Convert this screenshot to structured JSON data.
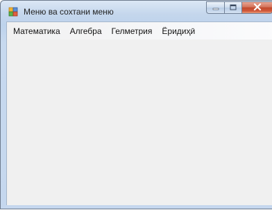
{
  "window": {
    "title": "Меню ва сохтани меню",
    "icon": "form-icon",
    "caption_buttons": {
      "minimize_icon": "minimize-icon",
      "maximize_icon": "maximize-icon",
      "close_icon": "close-icon"
    }
  },
  "menubar": {
    "items": [
      {
        "label": "Математика"
      },
      {
        "label": "Алгебра"
      },
      {
        "label": "Гелметрия"
      },
      {
        "label": "Ёридиҳӣ"
      }
    ]
  },
  "colors": {
    "frame": "#c4d6ec",
    "client": "#f0f0f0",
    "close_button": "#c24a2d"
  }
}
